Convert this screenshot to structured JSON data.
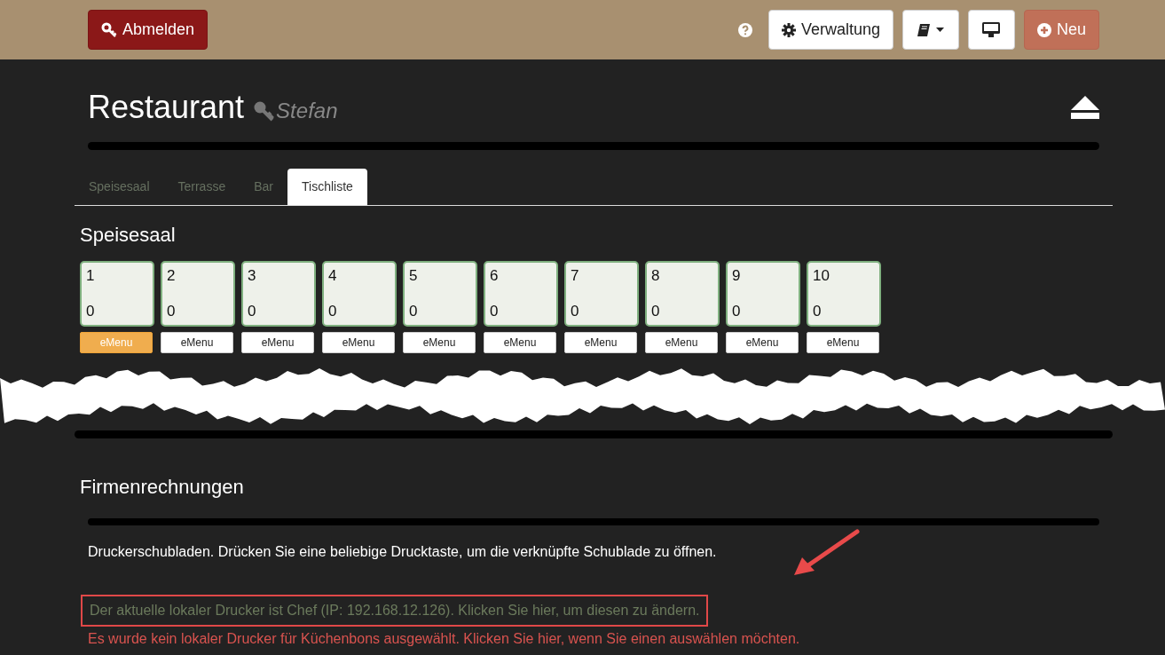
{
  "topbar": {
    "logout_button": "Abmelden",
    "admin_button": "Verwaltung",
    "new_button": "Neu"
  },
  "header": {
    "title": "Restaurant",
    "user": "Stefan"
  },
  "tabs": [
    {
      "label": "Speisesaal",
      "selected": false
    },
    {
      "label": "Terrasse",
      "selected": false
    },
    {
      "label": "Bar",
      "selected": false
    },
    {
      "label": "Tischliste",
      "selected": true
    }
  ],
  "section": {
    "title": "Speisesaal",
    "tables": [
      {
        "number": "1",
        "count": "0",
        "emenu": "eMenu",
        "active": true
      },
      {
        "number": "2",
        "count": "0",
        "emenu": "eMenu",
        "active": false
      },
      {
        "number": "3",
        "count": "0",
        "emenu": "eMenu",
        "active": false
      },
      {
        "number": "4",
        "count": "0",
        "emenu": "eMenu",
        "active": false
      },
      {
        "number": "5",
        "count": "0",
        "emenu": "eMenu",
        "active": false
      },
      {
        "number": "6",
        "count": "0",
        "emenu": "eMenu",
        "active": false
      },
      {
        "number": "7",
        "count": "0",
        "emenu": "eMenu",
        "active": false
      },
      {
        "number": "8",
        "count": "0",
        "emenu": "eMenu",
        "active": false
      },
      {
        "number": "9",
        "count": "0",
        "emenu": "eMenu",
        "active": false
      },
      {
        "number": "10",
        "count": "0",
        "emenu": "eMenu",
        "active": false
      }
    ]
  },
  "billing": {
    "title": "Firmenrechnungen",
    "note": "Druckerschubladen. Drücken Sie eine beliebige Drucktaste, um die verknüpfte Schublade zu öffnen.",
    "printer_status": "Der aktuelle lokaler Drucker ist Chef (IP: 192.168.12.126). Klicken Sie hier, um diesen zu ändern.",
    "kitchen_printer_status": "Es wurde kein lokaler Drucker für Küchenbons ausgewählt. Klicken Sie hier, wenn Sie einen auswählen möchten."
  }
}
